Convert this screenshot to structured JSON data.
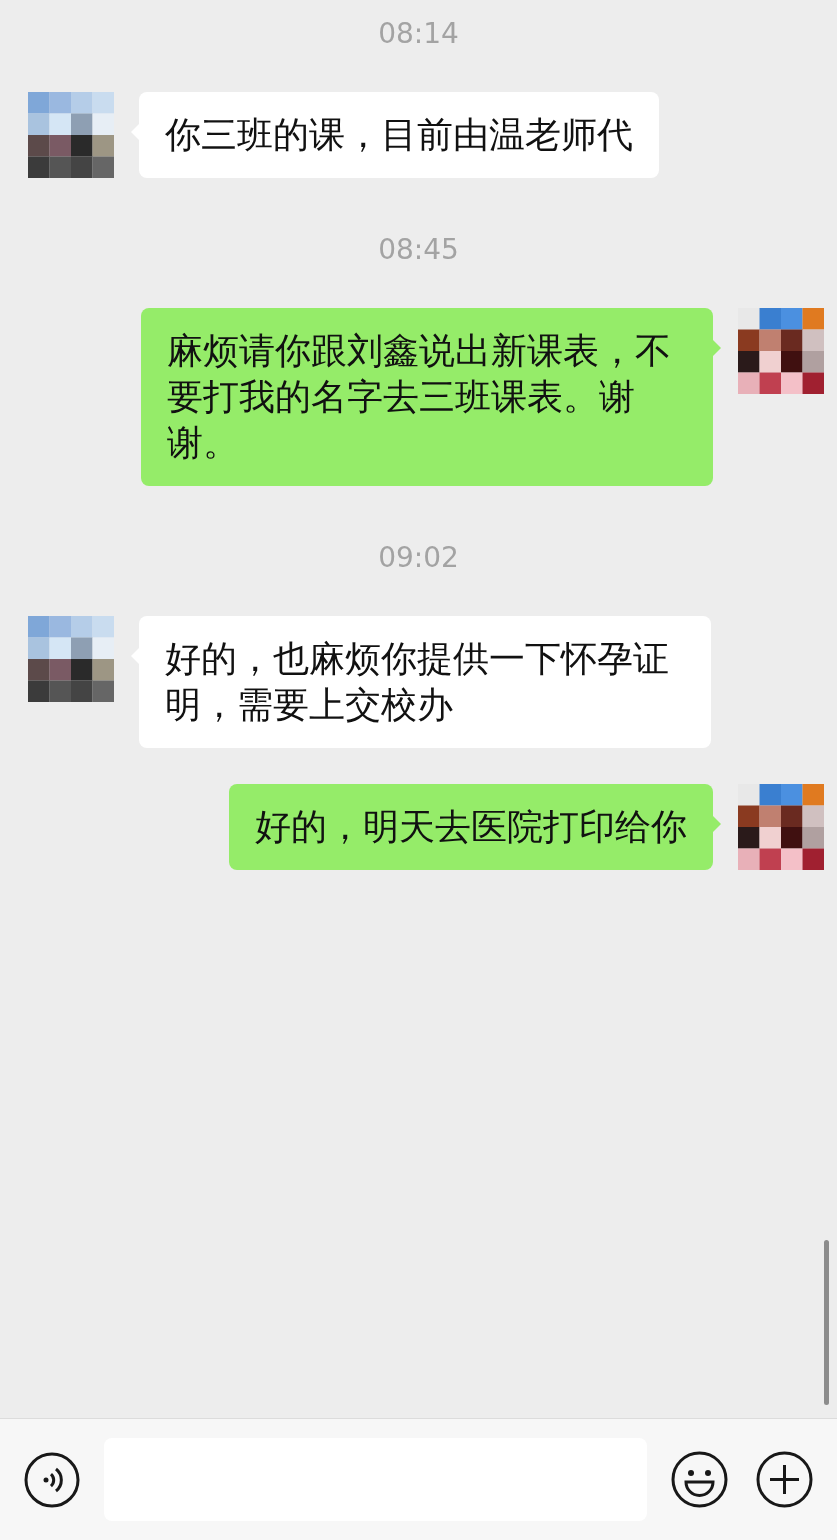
{
  "messages": [
    {
      "kind": "time",
      "text": "08:14"
    },
    {
      "kind": "received",
      "text": "你三班的课，目前由温老师代"
    },
    {
      "kind": "time",
      "text": "08:45"
    },
    {
      "kind": "sent",
      "text": "麻烦请你跟刘鑫说出新课表，不要打我的名字去三班课表。谢谢。"
    },
    {
      "kind": "time",
      "text": "09:02"
    },
    {
      "kind": "received",
      "text": "好的，也麻烦你提供一下怀孕证明，需要上交校办"
    },
    {
      "kind": "sent",
      "text": "好的，明天去医院打印给你"
    }
  ]
}
